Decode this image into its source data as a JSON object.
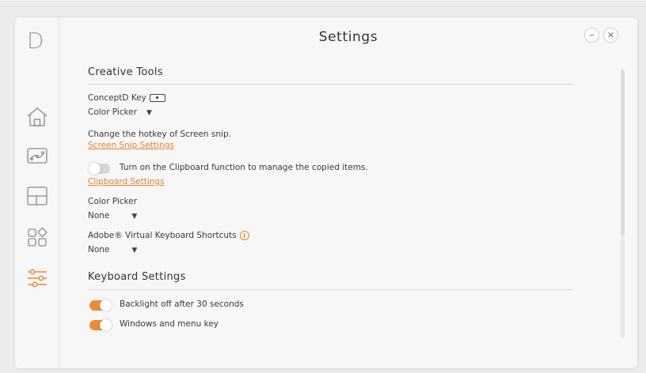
{
  "app": {
    "logo": "D",
    "title": "Settings"
  },
  "window_controls": {
    "minimize": "–",
    "close": "✕"
  },
  "sidebar": {
    "items": [
      {
        "name": "home",
        "icon": "home-icon"
      },
      {
        "name": "color-calibration",
        "icon": "curve-icon"
      },
      {
        "name": "layout",
        "icon": "layout-icon"
      },
      {
        "name": "apps",
        "icon": "apps-icon"
      },
      {
        "name": "settings",
        "icon": "sliders-icon",
        "active": true
      }
    ]
  },
  "creative_tools": {
    "heading": "Creative Tools",
    "conceptd_key_label": "ConceptD Key",
    "conceptd_key_value": "Color Picker",
    "hotkey_text": "Change the hotkey of Screen snip.",
    "screen_snip_link": "Screen Snip Settings",
    "clipboard_toggle_label": "Turn on the Clipboard function to manage the copied items.",
    "clipboard_toggle_on": false,
    "clipboard_link": "Clipboard Settings",
    "color_picker_label": "Color Picker",
    "color_picker_value": "None",
    "adobe_label": "Adobe® Virtual Keyboard Shortcuts",
    "adobe_value": "None",
    "dropdown_arrow": "▼",
    "info_glyph": "i"
  },
  "keyboard_settings": {
    "heading": "Keyboard Settings",
    "backlight_label": "Backlight off after 30 seconds",
    "backlight_on": true,
    "windows_key_label": "Windows and menu key",
    "windows_key_on": true
  },
  "colors": {
    "accent": "#ef8a2f",
    "link": "#e8812a",
    "icon_gray": "#8a8a8a"
  }
}
